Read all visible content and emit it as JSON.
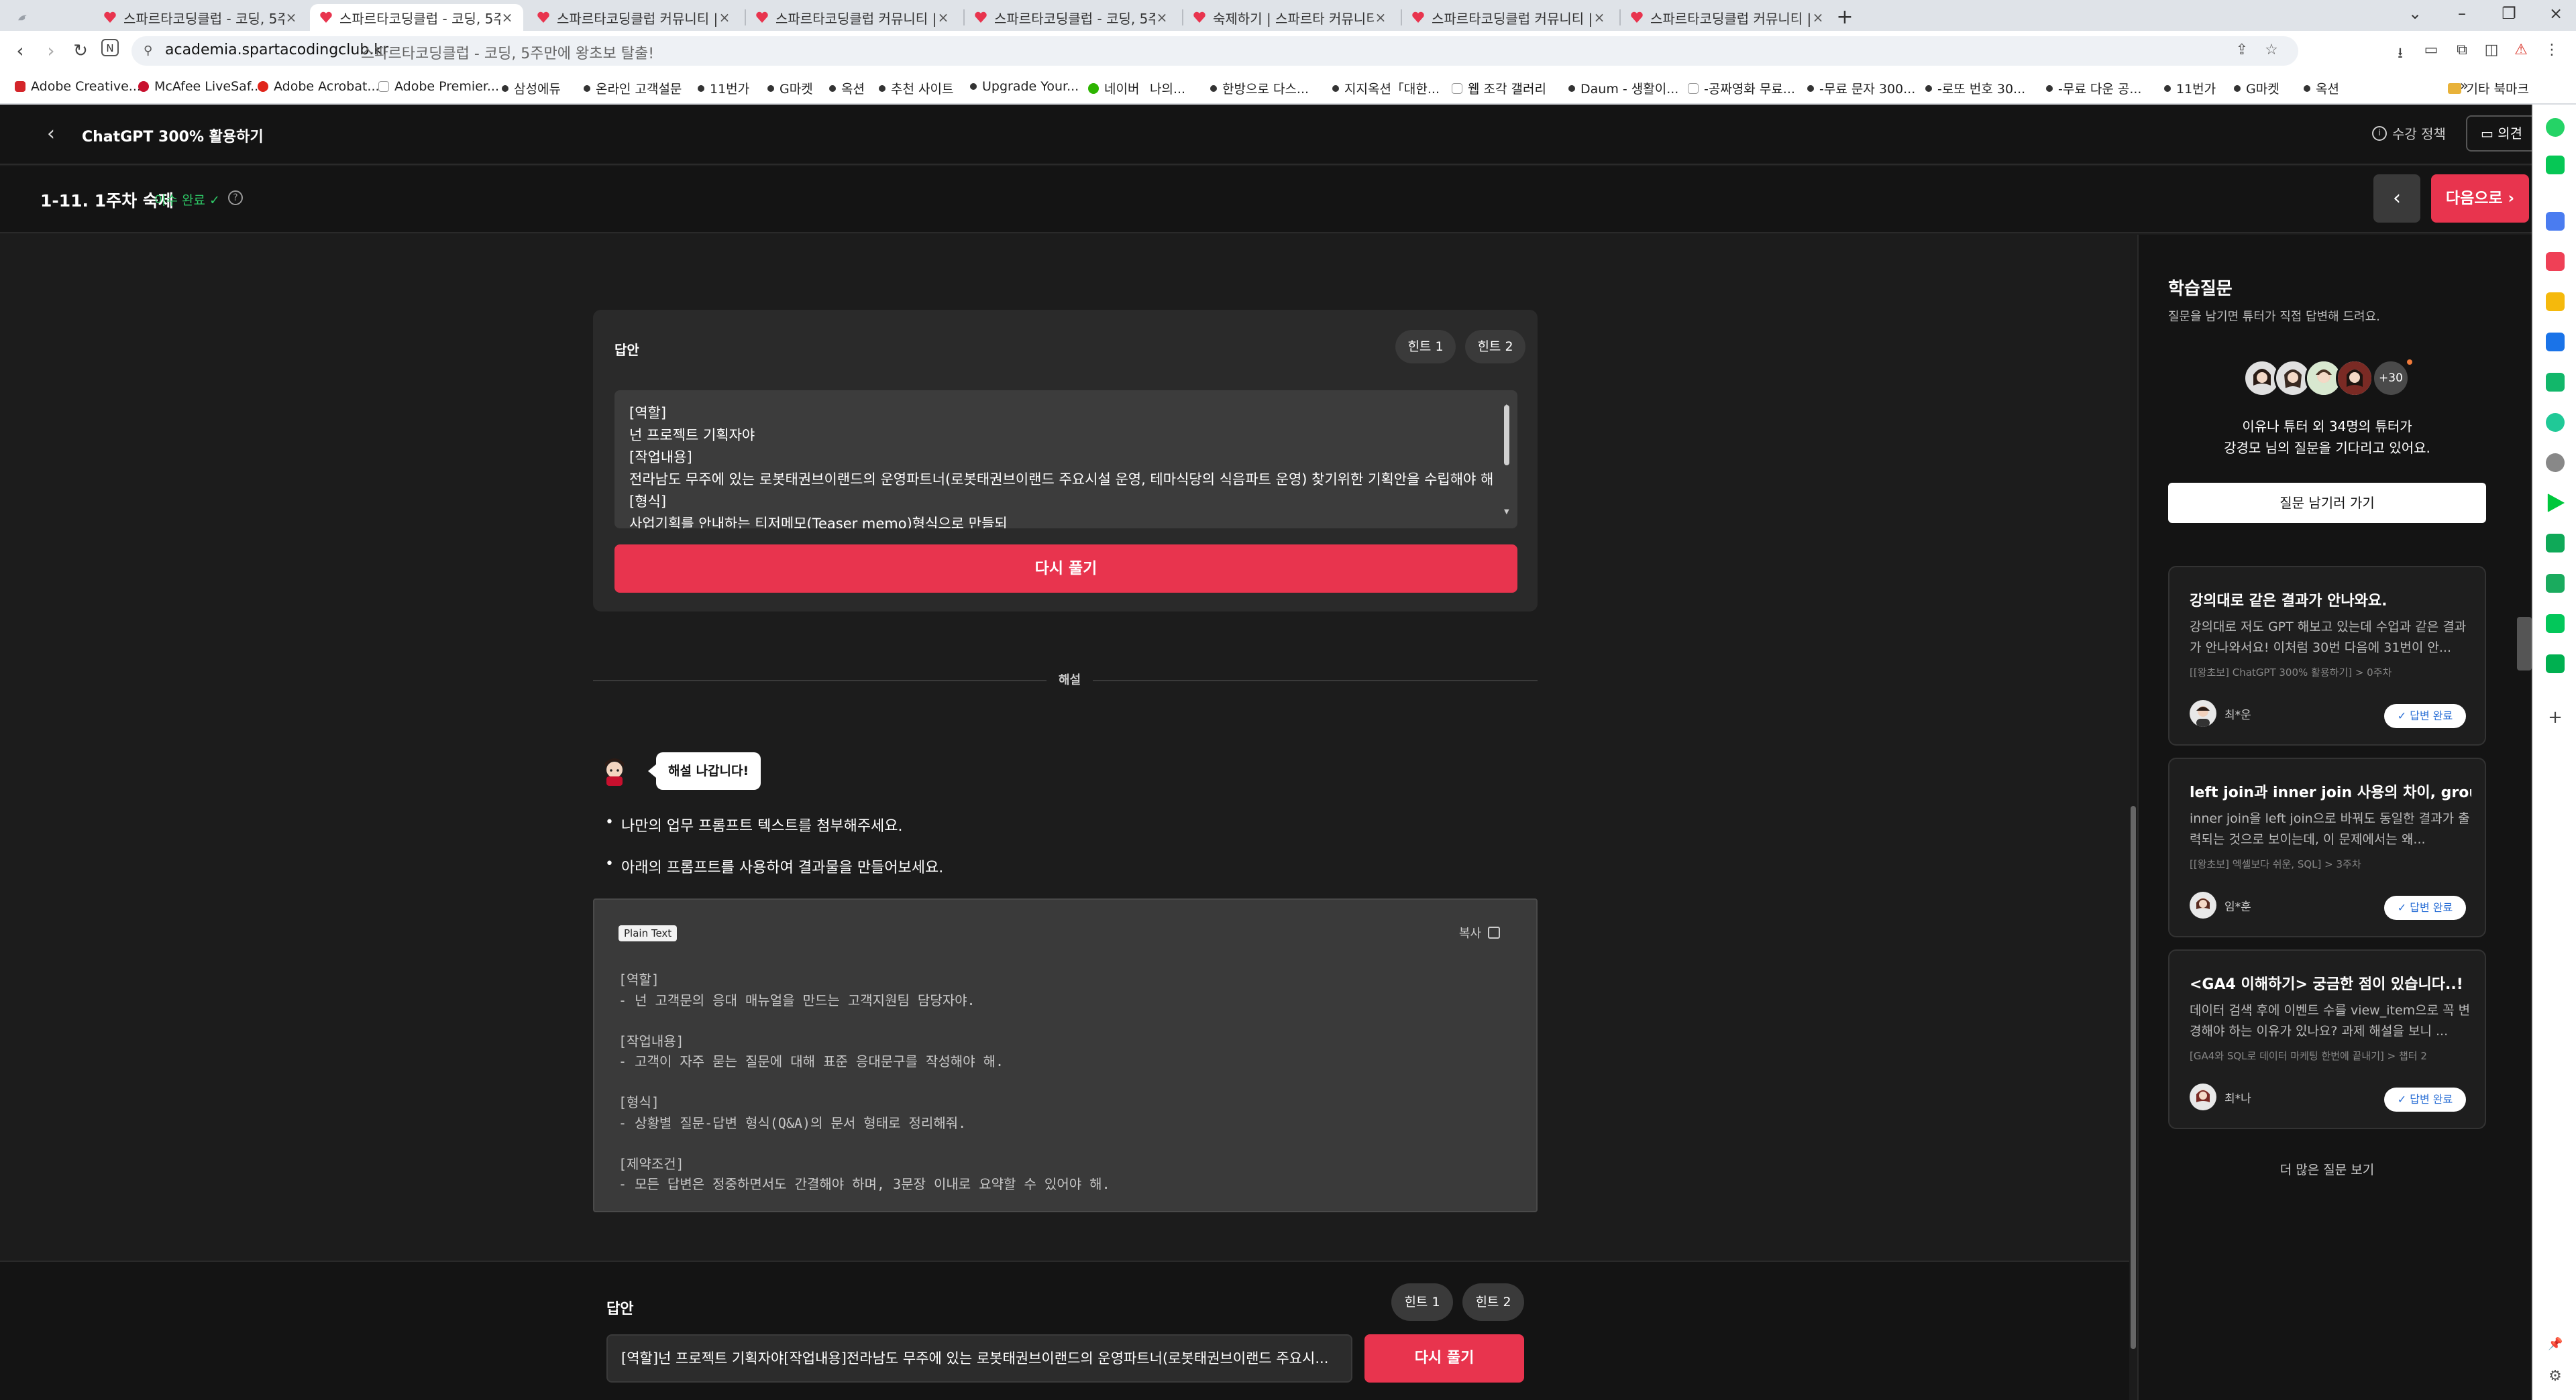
{
  "browser": {
    "tabs": [
      {
        "title": "스파르타코딩클럽 - 코딩, 5주만",
        "active": false
      },
      {
        "title": "스파르타코딩클럽 - 코딩, 5주만",
        "active": true
      },
      {
        "title": "스파르타코딩클럽 커뮤니티 | 스",
        "active": false
      },
      {
        "title": "스파르타코딩클럽 커뮤니티 | 스",
        "active": false
      },
      {
        "title": "스파르타코딩클럽 - 코딩, 5주만",
        "active": false
      },
      {
        "title": "숙제하기 | 스파르타 커뮤니티",
        "active": false
      },
      {
        "title": "스파르타코딩클럽 커뮤니티 | 스",
        "active": false
      },
      {
        "title": "스파르타코딩클럽 커뮤니티 | 스",
        "active": false
      }
    ],
    "url_host": "academia.spartacodingclub.kr",
    "url_title": "스파르타코딩클럽 - 코딩, 5주만에 왕초보 탈출!",
    "bookmarks": [
      "Adobe Creative...",
      "McAfee LiveSaf...",
      "Adobe Acrobat...",
      "Adobe Premier...",
      "삼성에듀",
      "온라인 고객설문",
      "11번가",
      "G마켓",
      "옥션",
      "추천 사이트",
      "Upgrade Your...",
      "네이버",
      "나의...",
      "한방으로 다스...",
      "지지옥션「대한...",
      "웹 조각 갤러리",
      "Daum - 생활이...",
      "-공짜영화 무료...",
      "-무료 문자 300...",
      "-로또 번호 30...",
      "-무료 다운 공...",
      "11번가",
      "G마켓",
      "옥션"
    ],
    "bookmark_folder": "기타 북마크",
    "bookmark_more": "»"
  },
  "header": {
    "course_title": "ChatGPT 300% 활용하기",
    "policy": "수강 정책",
    "opinion": "의견"
  },
  "lesson": {
    "title": "1-11. 1주차 숙제",
    "status": "이수 완료 ✓",
    "next_label": "다음으로 ›",
    "prev_label": "‹"
  },
  "answer_card": {
    "label": "답안",
    "hint1": "힌트 1",
    "hint2": "힌트 2",
    "lines": [
      "[역할]",
      "넌 프로젝트 기획자야",
      "[작업내용]",
      "전라남도 무주에 있는 로봇태권브이랜드의 운영파트너(로봇태권브이랜드 주요시설 운영, 테마식당의 식음파트 운영) 찾기위한 기획안을 수립해야 해",
      "[형식]",
      "사업기획를 안내하는 티저메모(Teaser memo)형식으로 만들되"
    ],
    "retry": "다시 풀기"
  },
  "explanation": {
    "divider": "해설",
    "bubble": "해설 나갑니다!",
    "bullets": [
      "나만의 업무 프롬프트 텍스트를 첨부해주세요.",
      "아래의 프롬프트를 사용하여 결과물을 만들어보세요."
    ],
    "code_lang": "Plain Text",
    "copy": "복사",
    "code": "[역할]\n- 넌 고객문의 응대 매뉴얼을 만드는 고객지원팀 담당자야.\n\n[작업내용]\n- 고객이 자주 묻는 질문에 대해 표준 응대문구를 작성해야 해.\n\n[형식]\n- 상황별 질문-답변 형식(Q&A)의 문서 형태로 정리해줘.\n\n[제약조건]\n- 모든 답변은 정중하면서도 간결해야 하며, 3문장 이내로 요약할 수 있어야 해."
  },
  "bottom": {
    "label": "답안",
    "hint1": "힌트 1",
    "hint2": "힌트 2",
    "input_value": "[역할]넌 프로젝트 기획자야[작업내용]전라남도 무주에 있는 로봇태권브이랜드의 운영파트너(로봇태권브이랜드 주요시...",
    "retry": "다시 풀기"
  },
  "questions_panel": {
    "title": "학습질문",
    "subtitle": "질문을 남기면 튜터가 직접 답변해 드려요.",
    "more_count": "+30",
    "waiting_line1": "이유나 튜터 외 34명의 튜터가",
    "waiting_line2": "강경모 님의 질문을 기다리고 있어요.",
    "ask_button": "질문 남기러 가기",
    "cards": [
      {
        "title": "강의대로 같은 결과가 안나와요.",
        "body": "강의대로 저도 GPT 해보고 있는데 수업과 같은 결과가 안나와서요! 이처럼 30번 다음에 31번이 안...",
        "tag": "[[왕초보] ChatGPT 300% 활용하기] > 0주차",
        "user": "최*운",
        "status": "✓ 답변 완료"
      },
      {
        "title": "left join과 inner join 사용의 차이, group...",
        "body": "inner join을 left join으로 바꿔도 동일한 결과가 출력되는 것으로 보이는데, 이 문제에서는 왜...",
        "tag": "[[왕초보] 엑셀보다 쉬운, SQL] > 3주차",
        "user": "임*훈",
        "status": "✓ 답변 완료"
      },
      {
        "title": "<GA4 이해하기> 궁금한 점이 있습니다..!",
        "body": "데이터 검색 후에 이벤트 수를 view_item으로 꼭 변경해야 하는 이유가 있나요? 과제 해설을 보니 ...",
        "tag": "[GA4와 SQL로 데이터 마케팅 한번에 끝내기] > 챕터 2",
        "user": "최*나",
        "status": "✓ 답변 완료"
      }
    ],
    "more_questions": "더 많은 질문 보기"
  },
  "colors": {
    "accent": "#e8344e",
    "success": "#2ec866",
    "bg": "#1c1c1c",
    "panel": "#141414"
  }
}
